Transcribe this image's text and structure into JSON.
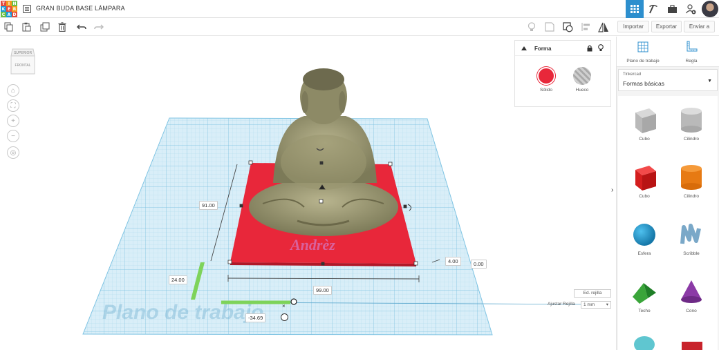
{
  "app": {
    "logo_letters": [
      "T",
      "I",
      "N",
      "K",
      "E",
      "R",
      "C",
      "A",
      "D"
    ],
    "logo_colors": [
      "#e54b3d",
      "#f39a1e",
      "#6cbe45",
      "#1b9bd7",
      "#e54b3d",
      "#f39a1e",
      "#6cbe45",
      "#1b9bd7",
      "#e54b3d"
    ],
    "project_title": "GRAN BUDA BASE LÁMPARA",
    "accent": "#2d8fce"
  },
  "header_icons": [
    "grid-view-icon",
    "pickaxe-icon",
    "briefcase-icon",
    "add-user-icon",
    "avatar"
  ],
  "toolbar": {
    "left_tools": [
      "copy-icon",
      "paste-icon",
      "duplicate-icon",
      "delete-icon",
      "undo-icon",
      "redo-icon"
    ],
    "right_tools": [
      "lightbulb-icon",
      "note-icon",
      "group-icon",
      "align-icon",
      "mirror-icon"
    ],
    "import_label": "Importar",
    "export_label": "Exportar",
    "send_label": "Enviar a"
  },
  "viewcube": {
    "top_label": "SUPERIOR",
    "front_label": "FRONTAL"
  },
  "viewport": {
    "workplane_label": "Plano de trabajo",
    "dimensions": {
      "height": "91.00",
      "width": "99.00",
      "depth": "24.00",
      "elevation": "4.00",
      "elevation_right": "0.00",
      "offset": "-34.69"
    },
    "base_text": "Andrèz",
    "edit_grid_label": "Ed. rejilla",
    "snap_grid_label": "Ajustar Rejilla",
    "snap_grid_value": "1 mm"
  },
  "inspector": {
    "title": "Forma",
    "solid_label": "Sólido",
    "hole_label": "Hueco",
    "solid_color": "#e8273a"
  },
  "right_panel": {
    "workplane_tool_label": "Plano de trabajo",
    "ruler_tool_label": "Regla",
    "library_category": "Tinkercad",
    "library_name": "Formas básicas",
    "shapes": [
      {
        "label": "Cubo"
      },
      {
        "label": "Cilindro"
      },
      {
        "label": "Cubo"
      },
      {
        "label": "Cilindro"
      },
      {
        "label": "Esfera"
      },
      {
        "label": "Scribble"
      },
      {
        "label": "Techo"
      },
      {
        "label": "Cono"
      }
    ]
  }
}
